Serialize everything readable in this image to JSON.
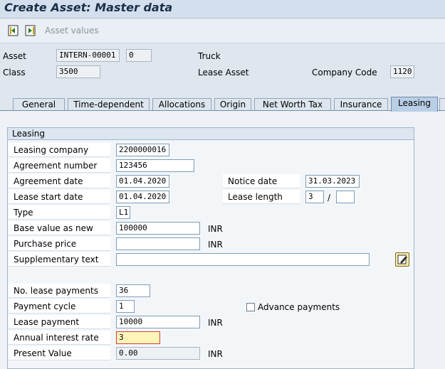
{
  "window": {
    "title": "Create Asset:  Master data"
  },
  "toolbar": {
    "asset_values_label": "Asset values"
  },
  "header": {
    "asset_label": "Asset",
    "asset_number": "INTERN-00001",
    "asset_subnumber": "0",
    "asset_description": "Truck",
    "class_label": "Class",
    "class_value": "3500",
    "class_description": "Lease Asset",
    "company_code_label": "Company Code",
    "company_code_value": "1120"
  },
  "tabs": [
    {
      "label": "General"
    },
    {
      "label": "Time-dependent"
    },
    {
      "label": "Allocations"
    },
    {
      "label": "Origin"
    },
    {
      "label": "Net Worth Tax"
    },
    {
      "label": "Insurance"
    },
    {
      "label": "Leasing"
    }
  ],
  "leasing": {
    "group_title": "Leasing",
    "leasing_company_label": "Leasing company",
    "leasing_company_value": "2200000016",
    "agreement_number_label": "Agreement number",
    "agreement_number_value": "123456",
    "agreement_date_label": "Agreement date",
    "agreement_date_value": "01.04.2020",
    "notice_date_label": "Notice date",
    "notice_date_value": "31.03.2023",
    "lease_start_label": "Lease start date",
    "lease_start_value": "01.04.2020",
    "lease_length_label": "Lease length",
    "lease_length_years": "3",
    "lease_length_sep": "/",
    "lease_length_periods": "",
    "type_label": "Type",
    "type_value": "L1",
    "base_value_label": "Base value as new",
    "base_value_value": "100000",
    "base_value_unit": "INR",
    "purchase_price_label": "Purchase price",
    "purchase_price_value": "",
    "purchase_price_unit": "INR",
    "supp_text_label": "Supplementary text",
    "supp_text_value": "",
    "no_payments_label": "No. lease payments",
    "no_payments_value": "36",
    "payment_cycle_label": "Payment cycle",
    "payment_cycle_value": "1",
    "advance_payments_label": "Advance payments",
    "lease_payment_label": "Lease payment",
    "lease_payment_value": "10000",
    "lease_payment_unit": "INR",
    "interest_rate_label": "Annual interest rate",
    "interest_rate_value": "3",
    "present_value_label": "Present Value",
    "present_value_value": "0.00",
    "present_value_unit": "INR"
  }
}
